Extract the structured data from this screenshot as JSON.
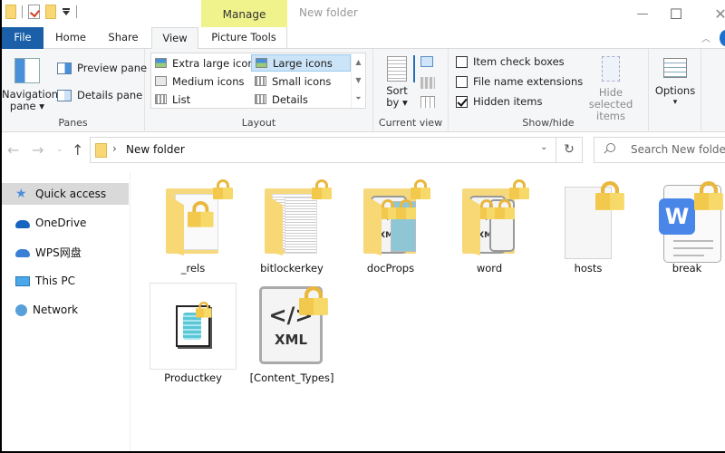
{
  "title_bar": {
    "context_tab": "Manage",
    "window_title": "New folder",
    "minimize": "—",
    "maximize": "☐",
    "close": "✕"
  },
  "tabs": [
    {
      "label": "File"
    },
    {
      "label": "Home"
    },
    {
      "label": "Share"
    },
    {
      "label": "View",
      "active": true
    },
    {
      "label": "Picture Tools"
    }
  ],
  "ribbon": {
    "panes": {
      "label": "Panes",
      "navigation_pane_line1": "Navigation",
      "navigation_pane_line2": "pane ▾",
      "preview_pane": "Preview pane",
      "details_pane": "Details pane"
    },
    "layout": {
      "label": "Layout",
      "options": [
        "Extra large icons",
        "Large icons",
        "Medium icons",
        "Small icons",
        "List",
        "Details"
      ],
      "selected": "Large icons"
    },
    "current_view": {
      "label": "Current view",
      "sort_by_line1": "Sort",
      "sort_by_line2": "by ▾"
    },
    "show_hide": {
      "label": "Show/hide",
      "item_check_boxes": {
        "label": "Item check boxes",
        "checked": false
      },
      "file_name_extensions": {
        "label": "File name extensions",
        "checked": false
      },
      "hidden_items": {
        "label": "Hidden items",
        "checked": true
      },
      "hide_selected_line1": "Hide selected",
      "hide_selected_line2": "items"
    },
    "options": {
      "label": "Options",
      "arrow": "▾"
    }
  },
  "address_bar": {
    "path": "New folder",
    "search_placeholder": "Search New folder"
  },
  "sidebar": {
    "items": [
      {
        "label": "Quick access",
        "icon": "star-icon",
        "active": true
      },
      {
        "label": "OneDrive",
        "icon": "cloud-icon"
      },
      {
        "label": "WPS网盘",
        "icon": "wps-cloud-icon"
      },
      {
        "label": "This PC",
        "icon": "monitor-icon"
      },
      {
        "label": "Network",
        "icon": "network-icon"
      }
    ]
  },
  "files": [
    {
      "name": "_rels",
      "type": "folder",
      "locked": true
    },
    {
      "name": "bitlockerkey",
      "type": "folder",
      "locked": true
    },
    {
      "name": "docProps",
      "type": "folder",
      "locked": true
    },
    {
      "name": "word",
      "type": "folder",
      "locked": true
    },
    {
      "name": "hosts",
      "type": "file",
      "locked": true
    },
    {
      "name": "break",
      "type": "wps-document",
      "locked": true
    },
    {
      "name": "Productkey",
      "type": "script",
      "locked": true
    },
    {
      "name": "[Content_Types]",
      "type": "xml",
      "locked": true
    }
  ],
  "xml_label": "XML",
  "xml_glyph": "</>",
  "wps_letter": "W"
}
